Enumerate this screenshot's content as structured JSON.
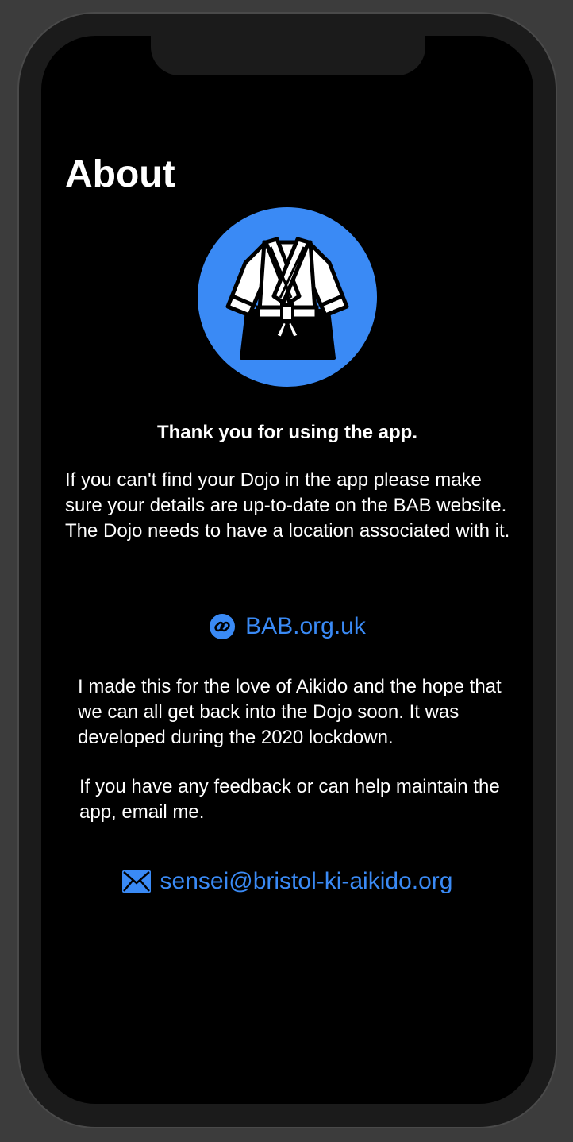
{
  "header": {
    "title": "About"
  },
  "content": {
    "thanks": "Thank you for using the app.",
    "paragraph_1": "If you can't find your Dojo in the app please make sure your details are up-to-date on the BAB website. The Dojo needs to have a location associated with it.",
    "website_link": "BAB.org.uk",
    "paragraph_2": "I made this for the love of Aikido and the hope that we can all get back into the Dojo soon. It was developed during the 2020 lockdown.",
    "paragraph_3": "If you have any feedback or can help maintain the app, email me.",
    "email_link": "sensei@bristol-ki-aikido.org"
  },
  "icons": {
    "logo": "gi-uniform-icon",
    "website": "link-icon",
    "email": "envelope-icon"
  },
  "colors": {
    "background": "#000000",
    "accent": "#3a8af5",
    "text": "#ffffff"
  }
}
